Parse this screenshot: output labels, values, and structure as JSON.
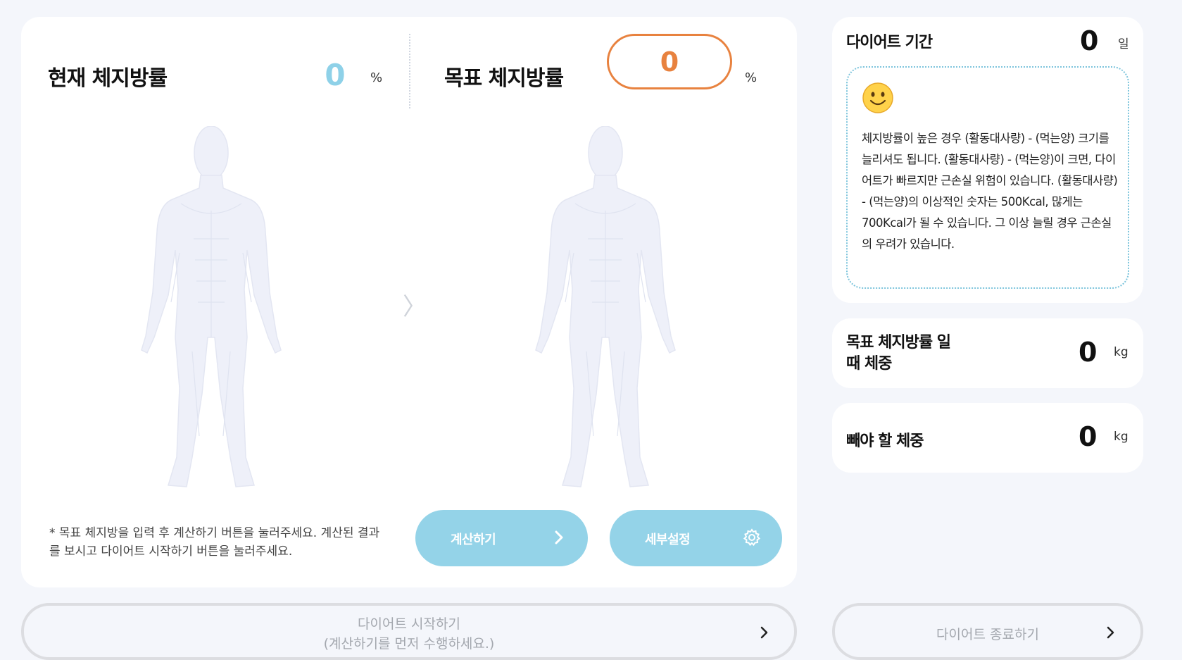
{
  "current": {
    "label": "현재 체지방률",
    "value": "0",
    "unit": "%"
  },
  "target": {
    "label": "목표 체지방률",
    "value": "0",
    "unit": "%"
  },
  "hint": "* 목표 체지방을 입력 후 계산하기 버튼을 눌러주세요. 계산된 결과를 보시고 다이어트 시작하기 버튼을 눌러주세요.",
  "buttons": {
    "calculate": "계산하기",
    "detail": "세부설정",
    "start_line1": "다이어트 시작하기",
    "start_line2": "(계산하기를 먼저 수행하세요.)",
    "end": "다이어트 종료하기"
  },
  "period": {
    "label": "다이어트 기간",
    "value": "0",
    "unit": "일",
    "info": "체지방률이 높은 경우 (활동대사량) - (먹는양) 크기를 늘리셔도 됩니다. (활동대사량) - (먹는양)이 크면, 다이어트가 빠르지만 근손실 위험이 있습니다. (활동대사량) - (먹는양)의 이상적인 숫자는 500Kcal, 많게는 700Kcal가 될 수 있습니다. 그 이상 늘릴 경우 근손실의 우려가 있습니다."
  },
  "target_weight": {
    "label_line1": "목표 체지방률 일",
    "label_line2": "때 체중",
    "value": "0",
    "unit": "kg"
  },
  "lose_weight": {
    "label": "빼야 할 체중",
    "value": "0",
    "unit": "kg"
  },
  "icons": {
    "smiley": "smiley-icon",
    "gear": "gear-icon",
    "chevron": "chevron-right-icon"
  }
}
